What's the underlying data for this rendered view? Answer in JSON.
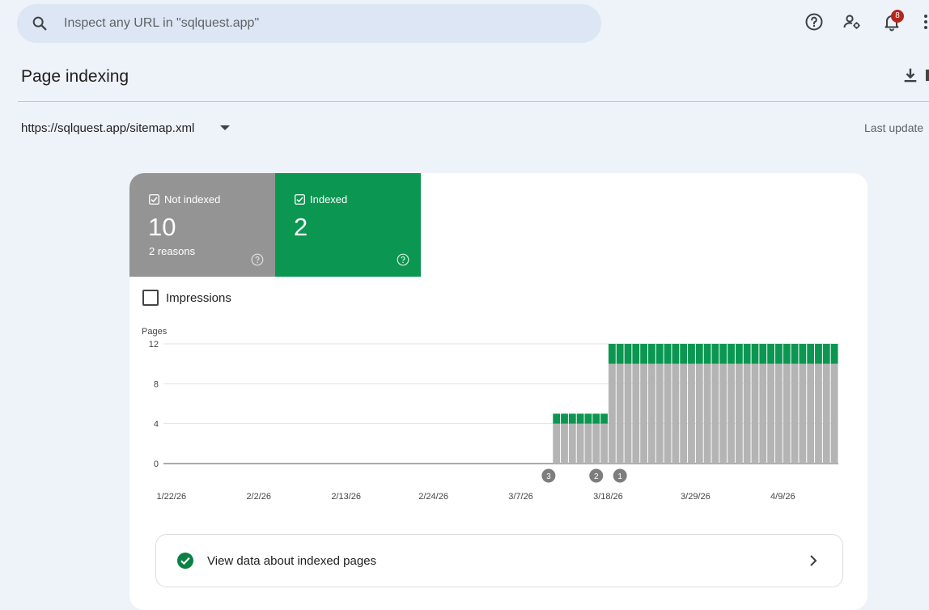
{
  "search": {
    "placeholder": "Inspect any URL in \"sqlquest.app\"",
    "icon": "search-icon"
  },
  "topbar": {
    "notification_count": "8",
    "icons": [
      "help-icon",
      "manage-users-icon",
      "notifications-icon",
      "more-vert-icon"
    ]
  },
  "page": {
    "title": "Page indexing",
    "sitemap": "https://sqlquest.app/sitemap.xml",
    "last_update": "Last update"
  },
  "tiles": {
    "not_indexed": {
      "label": "Not indexed",
      "count": "10",
      "sub": "2 reasons",
      "color": "#949494"
    },
    "indexed": {
      "label": "Indexed",
      "count": "2",
      "color": "#0b9651"
    }
  },
  "impressions_label": "Impressions",
  "view_row": {
    "label": "View data about indexed pages"
  },
  "chart_data": {
    "type": "bar",
    "stacked": true,
    "ylabel": "Pages",
    "ylim": [
      0,
      12
    ],
    "yticks": [
      0,
      4,
      8,
      12
    ],
    "grid": true,
    "x_tick_labels": [
      "1/22/26",
      "2/2/26",
      "2/13/26",
      "2/24/26",
      "3/7/26",
      "3/18/26",
      "3/29/26",
      "4/9/26"
    ],
    "x_tick_dates": [
      "2026-01-22",
      "2026-02-02",
      "2026-02-13",
      "2026-02-24",
      "2026-03-07",
      "2026-03-18",
      "2026-03-29",
      "2026-04-09"
    ],
    "x_range": [
      "2026-01-21",
      "2026-04-16"
    ],
    "series": [
      {
        "name": "Not indexed",
        "color": "#b4b4b4",
        "data": [
          {
            "from": "2026-03-11",
            "to": "2026-03-17",
            "value": 4
          },
          {
            "from": "2026-03-18",
            "to": "2026-04-15",
            "value": 10
          }
        ]
      },
      {
        "name": "Indexed",
        "color": "#0b9651",
        "data": [
          {
            "from": "2026-03-11",
            "to": "2026-03-17",
            "value": 1
          },
          {
            "from": "2026-03-18",
            "to": "2026-04-15",
            "value": 2
          }
        ]
      }
    ],
    "annotations": [
      {
        "label": "3",
        "date": "2026-03-10"
      },
      {
        "label": "2",
        "date": "2026-03-16"
      },
      {
        "label": "1",
        "date": "2026-03-19"
      }
    ]
  }
}
